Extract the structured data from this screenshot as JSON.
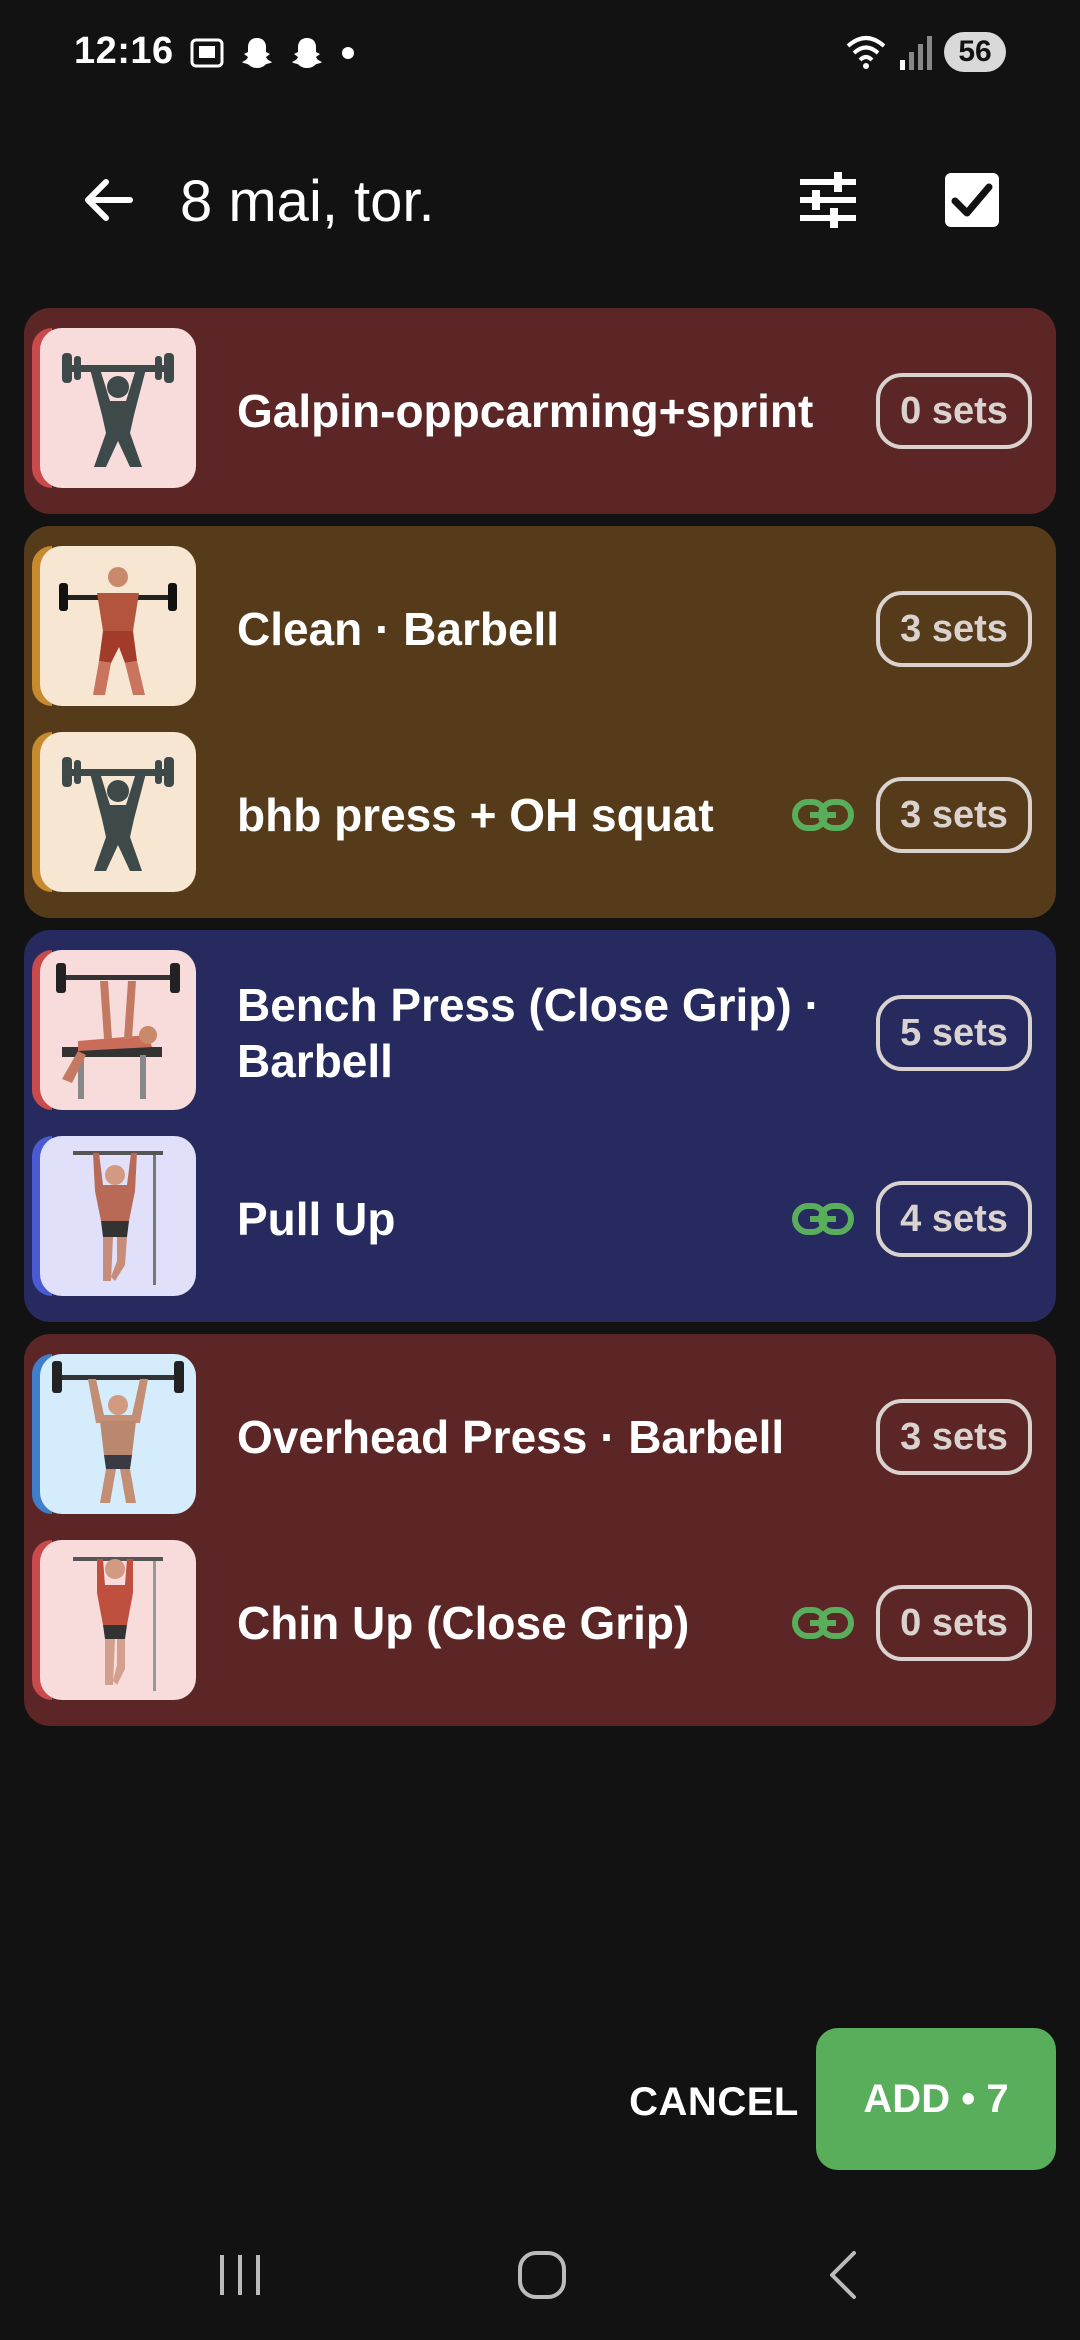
{
  "status_bar": {
    "time": "12:16",
    "battery": "56",
    "left_icons": [
      "screenshot-icon",
      "snapchat-icon",
      "snapchat-icon",
      "dot-icon"
    ],
    "right_icons": [
      "wifi-icon",
      "signal-icon"
    ]
  },
  "header": {
    "title": "8 mai, tor.",
    "icons": [
      "back-arrow-icon",
      "filter-sliders-icon",
      "checkbox-checked-icon"
    ]
  },
  "colors": {
    "background": "#121212",
    "group_red": "#5c2626",
    "group_brown": "#563b1a",
    "group_blue": "#262a5e",
    "accent_green": "#59ae5c"
  },
  "groups": [
    {
      "color": "red",
      "exercises": [
        {
          "name": "Galpin-oppcarming+sprint",
          "sets": "0 sets",
          "linked": false,
          "thumb": "generic-lifter-icon"
        }
      ]
    },
    {
      "color": "brown",
      "exercises": [
        {
          "name": "Clean · Barbell",
          "sets": "3 sets",
          "linked": false,
          "thumb": "clean-barbell-figure"
        },
        {
          "name": "bhb press + OH squat",
          "sets": "3 sets",
          "linked": true,
          "thumb": "generic-lifter-icon"
        }
      ]
    },
    {
      "color": "blue",
      "exercises": [
        {
          "name": "Bench Press (Close Grip) · Barbell",
          "sets": "5 sets",
          "linked": false,
          "thumb": "bench-press-figure"
        },
        {
          "name": "Pull Up",
          "sets": "4 sets",
          "linked": true,
          "thumb": "pull-up-figure"
        }
      ]
    },
    {
      "color": "red",
      "exercises": [
        {
          "name": "Overhead Press · Barbell",
          "sets": "3 sets",
          "linked": false,
          "thumb": "overhead-press-figure"
        },
        {
          "name": "Chin Up (Close Grip)",
          "sets": "0 sets",
          "linked": true,
          "thumb": "chin-up-figure"
        }
      ]
    }
  ],
  "actions": {
    "cancel_label": "CANCEL",
    "add_label": "ADD • 7"
  },
  "nav_bar": {
    "icons": [
      "recent-apps-icon",
      "home-icon",
      "back-icon"
    ]
  }
}
